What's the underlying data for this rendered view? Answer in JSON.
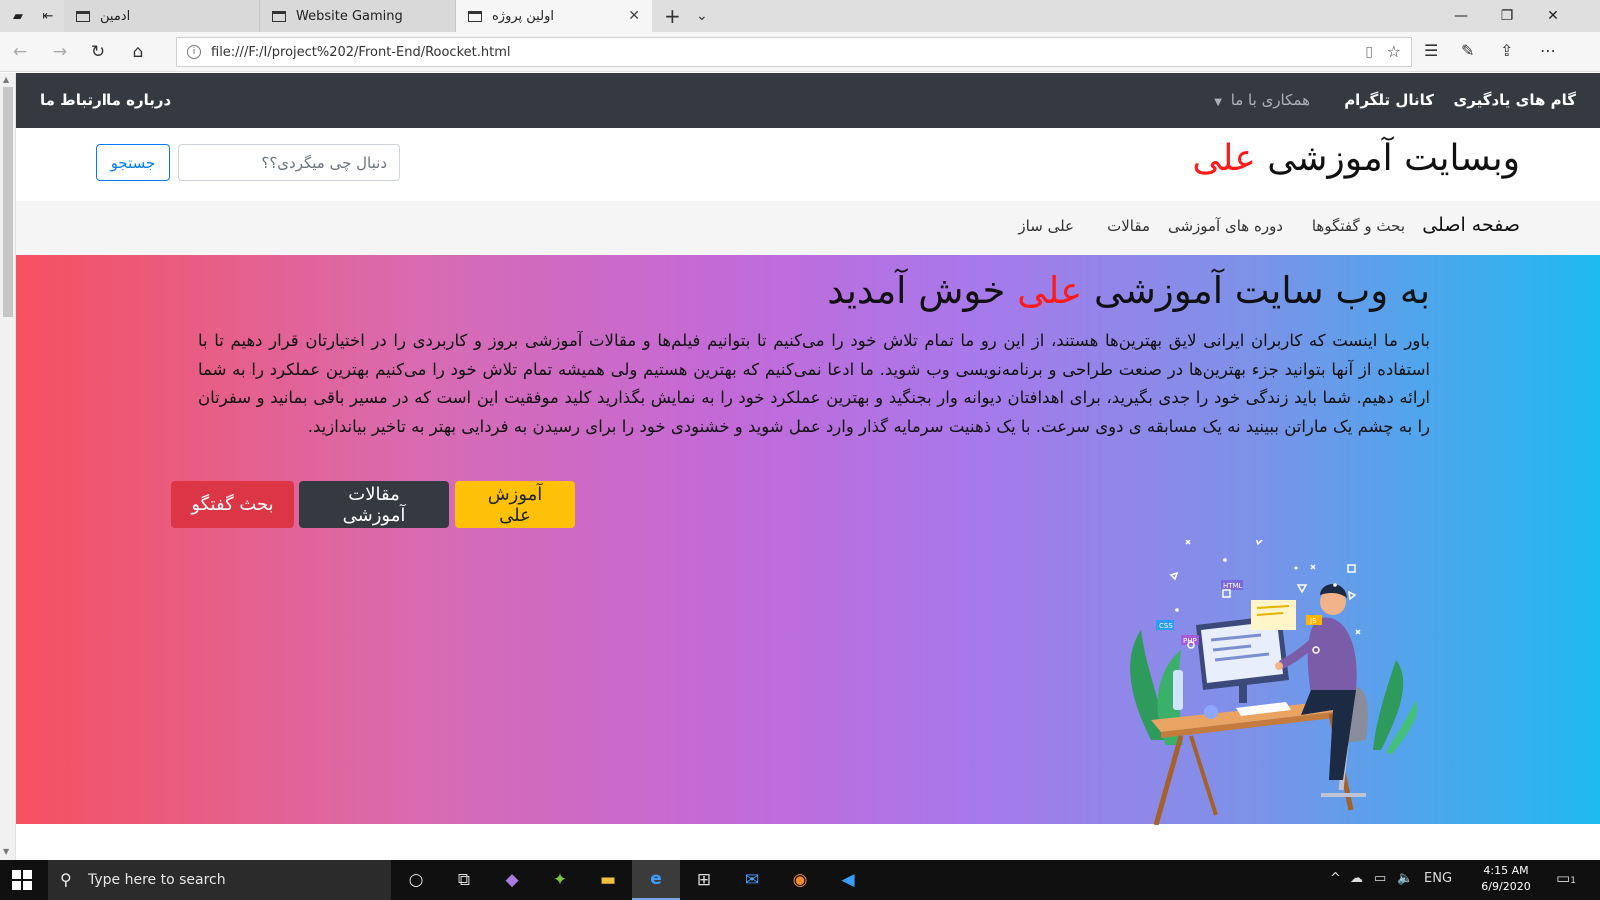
{
  "browser": {
    "tabs": [
      {
        "title": "ادمین",
        "active": false
      },
      {
        "title": "Website Gaming",
        "active": false
      },
      {
        "title": "اولین پروژه",
        "active": true
      }
    ],
    "url": "file:///F:/I/project%202/Front-End/Roocket.html"
  },
  "topnav": {
    "right_items": [
      "گام های یادگیری",
      "کانال تلگرام",
      "همکاری با ما"
    ],
    "left_items": [
      "درباره ما",
      "ارتباط ما"
    ]
  },
  "header": {
    "brand_prefix": "وبسایت آموزشی",
    "brand_highlight": "علی",
    "search_placeholder": "دنبال چی میگردی؟؟",
    "search_button": "جستجو"
  },
  "secnav": {
    "items": [
      "صفحه اصلی",
      "بحث و گفتگوها",
      "دوره های آموزشی",
      "مقالات",
      "علی ساز"
    ]
  },
  "hero": {
    "title_prefix": "به وب سایت آموزشی",
    "title_highlight": "علی",
    "title_suffix": "خوش آمدید",
    "paragraph": "باور ما اینست که کاربران ایرانی لایق بهترین‌ها هستند، از این رو ما تمام تلاش خود را می‌کنیم تا بتوانیم فیلم‌ها و مقالات آموزشی بروز و کاربردی را در اختیارتان قرار دهیم تا با استفاده از آنها بتوانید جزء بهترین‌ها در صنعت طراحی و برنامه‌نویسی وب شوید. ما ادعا نمی‌کنیم که بهترین هستیم ولی همیشه تمام تلاش خود را می‌کنیم بهترین عملکرد را به شما ارائه دهیم. شما باید زندگی خود را جدی بگیرید، برای اهدافتان دیوانه وار بجنگید و بهترین عملکرد خود را به نمایش بگذارید کلید موفقیت این است که در مسیر باقی بمانید و سفرتان را به چشم یک ماراتن ببینید نه یک مسابقه ی دوی سرعت. با یک ذهنیت سرمایه گذار وارد عمل شوید و خشنودی خود را برای رسیدن به فردایی بهتر به تاخیر بیاندازید.",
    "buttons": [
      "آموزش علی",
      "مقالات آموزشی",
      "بحث گفتگو"
    ],
    "illustration_labels": [
      "CSS",
      "PHP",
      "HTML",
      "JS"
    ]
  },
  "taskbar": {
    "search_placeholder": "Type here to search",
    "language": "ENG",
    "time": "4:15 AM",
    "date": "6/9/2020",
    "notification_count": "1"
  }
}
